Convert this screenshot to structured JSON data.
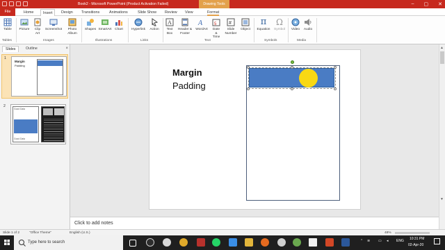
{
  "titlebar": {
    "title": "Book2 - Microsoft PowerPoint (Product Activation Failed)",
    "context_tab_group": "Drawing Tools",
    "minimize": "–",
    "maximize": "▢",
    "close": "✕"
  },
  "tabs": {
    "file": "File",
    "home": "Home",
    "insert": "Insert",
    "design": "Design",
    "transitions": "Transitions",
    "animations": "Animations",
    "slideshow": "Slide Show",
    "review": "Review",
    "view": "View",
    "format": "Format"
  },
  "ribbon": {
    "table": "Table",
    "picture": "Picture",
    "clipart": "Clip Art",
    "screenshot": "Screenshot",
    "photoalbum": "Photo Album",
    "shapes": "Shapes",
    "smartart": "SmartArt",
    "chart": "Chart",
    "hyperlink": "Hyperlink",
    "action": "Action",
    "textbox": "Text Box",
    "headerfooter": "Header & Footer",
    "wordart": "WordArt",
    "datetime": "Date & Time",
    "slidenumber": "Slide Number",
    "object": "Object",
    "equation": "Equation",
    "symbol": "Symbol",
    "video": "Video",
    "audio": "Audio",
    "groups": {
      "tables": "Tables",
      "images": "Images",
      "illustrations": "Illustrations",
      "links": "Links",
      "text": "Text",
      "symbols": "Symbols",
      "media": "Media"
    }
  },
  "panel": {
    "slides_tab": "Slides",
    "outline_tab": "Outline",
    "close": "×",
    "thumb1_num": "1",
    "thumb2_num": "2",
    "thumb1_line1": "Margin",
    "thumb1_line2": "Padding",
    "thumb2_top": "Good Data",
    "thumb2_bottom": "Good Data"
  },
  "slide": {
    "heading": "Margin",
    "subheading": "Padding"
  },
  "notes": {
    "placeholder": "Click to add notes"
  },
  "status": {
    "slide_count": "Slide 1 of 2",
    "theme": "\"Office Theme\"",
    "language": "English (U.S.)",
    "zoom": "48%"
  },
  "taskbar": {
    "search_placeholder": "Type here to search",
    "lang": "ENG",
    "time": "10:31 PM",
    "date": "02-Apr-20"
  },
  "colors": {
    "title_red": "#c7291e",
    "accent_orange": "#e3a14b",
    "shape_blue": "#4a7cc4",
    "circle_yellow": "#f8d814"
  }
}
